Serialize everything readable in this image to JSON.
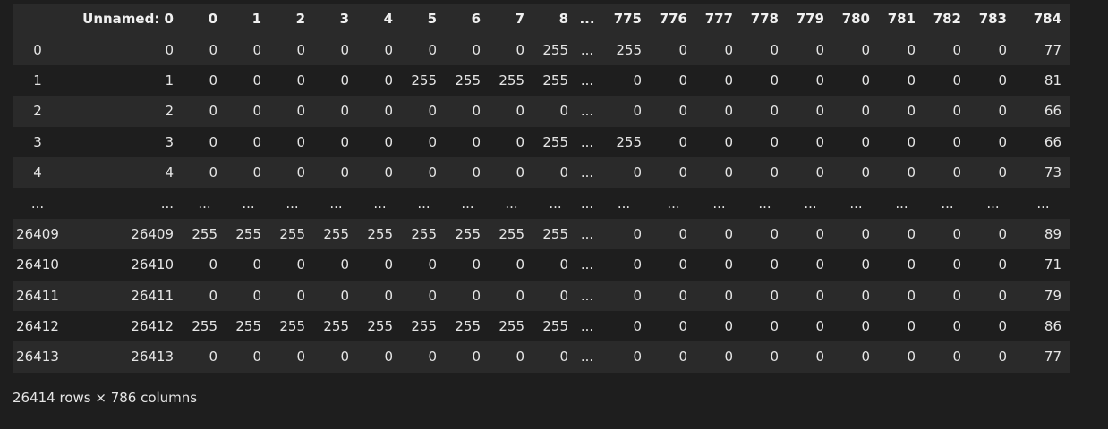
{
  "columns": [
    "",
    "Unnamed: 0",
    "0",
    "1",
    "2",
    "3",
    "4",
    "5",
    "6",
    "7",
    "8",
    "...",
    "775",
    "776",
    "777",
    "778",
    "779",
    "780",
    "781",
    "782",
    "783",
    "784"
  ],
  "rows": [
    [
      "0",
      "0",
      "0",
      "0",
      "0",
      "0",
      "0",
      "0",
      "0",
      "0",
      "255",
      "...",
      "255",
      "0",
      "0",
      "0",
      "0",
      "0",
      "0",
      "0",
      "0",
      "77"
    ],
    [
      "1",
      "1",
      "0",
      "0",
      "0",
      "0",
      "0",
      "255",
      "255",
      "255",
      "255",
      "...",
      "0",
      "0",
      "0",
      "0",
      "0",
      "0",
      "0",
      "0",
      "0",
      "81"
    ],
    [
      "2",
      "2",
      "0",
      "0",
      "0",
      "0",
      "0",
      "0",
      "0",
      "0",
      "0",
      "...",
      "0",
      "0",
      "0",
      "0",
      "0",
      "0",
      "0",
      "0",
      "0",
      "66"
    ],
    [
      "3",
      "3",
      "0",
      "0",
      "0",
      "0",
      "0",
      "0",
      "0",
      "0",
      "255",
      "...",
      "255",
      "0",
      "0",
      "0",
      "0",
      "0",
      "0",
      "0",
      "0",
      "66"
    ],
    [
      "4",
      "4",
      "0",
      "0",
      "0",
      "0",
      "0",
      "0",
      "0",
      "0",
      "0",
      "...",
      "0",
      "0",
      "0",
      "0",
      "0",
      "0",
      "0",
      "0",
      "0",
      "73"
    ],
    [
      "...",
      "...",
      "...",
      "...",
      "...",
      "...",
      "...",
      "...",
      "...",
      "...",
      "...",
      "...",
      "...",
      "...",
      "...",
      "...",
      "...",
      "...",
      "...",
      "...",
      "...",
      "..."
    ],
    [
      "26409",
      "26409",
      "255",
      "255",
      "255",
      "255",
      "255",
      "255",
      "255",
      "255",
      "255",
      "...",
      "0",
      "0",
      "0",
      "0",
      "0",
      "0",
      "0",
      "0",
      "0",
      "89"
    ],
    [
      "26410",
      "26410",
      "0",
      "0",
      "0",
      "0",
      "0",
      "0",
      "0",
      "0",
      "0",
      "...",
      "0",
      "0",
      "0",
      "0",
      "0",
      "0",
      "0",
      "0",
      "0",
      "71"
    ],
    [
      "26411",
      "26411",
      "0",
      "0",
      "0",
      "0",
      "0",
      "0",
      "0",
      "0",
      "0",
      "...",
      "0",
      "0",
      "0",
      "0",
      "0",
      "0",
      "0",
      "0",
      "0",
      "79"
    ],
    [
      "26412",
      "26412",
      "255",
      "255",
      "255",
      "255",
      "255",
      "255",
      "255",
      "255",
      "255",
      "...",
      "0",
      "0",
      "0",
      "0",
      "0",
      "0",
      "0",
      "0",
      "0",
      "86"
    ],
    [
      "26413",
      "26413",
      "0",
      "0",
      "0",
      "0",
      "0",
      "0",
      "0",
      "0",
      "0",
      "...",
      "0",
      "0",
      "0",
      "0",
      "0",
      "0",
      "0",
      "0",
      "0",
      "77"
    ]
  ],
  "footer": "26414 rows × 786 columns"
}
